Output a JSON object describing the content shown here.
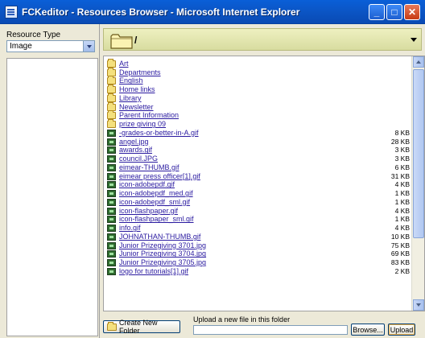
{
  "window": {
    "title": "FCKeditor - Resources Browser - Microsoft Internet Explorer",
    "min_glyph": "_",
    "max_glyph": "□",
    "close_glyph": "✕"
  },
  "sidebar": {
    "resource_type_label": "Resource Type",
    "resource_type_value": "Image"
  },
  "pathbar": {
    "path": "/"
  },
  "files": [
    {
      "type": "folder",
      "name": "Art",
      "size": ""
    },
    {
      "type": "folder",
      "name": "Departments",
      "size": ""
    },
    {
      "type": "folder",
      "name": "English",
      "size": ""
    },
    {
      "type": "folder",
      "name": "Home links",
      "size": ""
    },
    {
      "type": "folder",
      "name": "Library",
      "size": ""
    },
    {
      "type": "folder",
      "name": "Newsletter",
      "size": ""
    },
    {
      "type": "folder",
      "name": "Parent Information",
      "size": ""
    },
    {
      "type": "folder",
      "name": "prize giving 09",
      "size": ""
    },
    {
      "type": "image",
      "name": "-grades-or-better-in-A.gif",
      "size": "8 KB"
    },
    {
      "type": "image",
      "name": "angel.jpg",
      "size": "28 KB"
    },
    {
      "type": "image",
      "name": "awards.gif",
      "size": "3 KB"
    },
    {
      "type": "image",
      "name": "council.JPG",
      "size": "3 KB"
    },
    {
      "type": "image",
      "name": "eimear-THUMB.gif",
      "size": "6 KB"
    },
    {
      "type": "image",
      "name": "eimear press officer[1].gif",
      "size": "31 KB"
    },
    {
      "type": "image",
      "name": "icon-adobepdf.gif",
      "size": "4 KB"
    },
    {
      "type": "image",
      "name": "icon-adobepdf_med.gif",
      "size": "1 KB"
    },
    {
      "type": "image",
      "name": "icon-adobepdf_sml.gif",
      "size": "1 KB"
    },
    {
      "type": "image",
      "name": "icon-flashpaper.gif",
      "size": "4 KB"
    },
    {
      "type": "image",
      "name": "icon-flashpaper_sml.gif",
      "size": "1 KB"
    },
    {
      "type": "image",
      "name": "info.gif",
      "size": "4 KB"
    },
    {
      "type": "image",
      "name": "JOHNATHAN-THUMB.gif",
      "size": "10 KB"
    },
    {
      "type": "image",
      "name": "Junior Prizegiving 3701.jpg",
      "size": "75 KB"
    },
    {
      "type": "image",
      "name": "Junior Prizegiving 3704.jpg",
      "size": "69 KB"
    },
    {
      "type": "image",
      "name": "Junior Prizegiving 3705.jpg",
      "size": "83 KB"
    },
    {
      "type": "image",
      "name": "logo for tutorials[1].gif",
      "size": "2 KB"
    }
  ],
  "bottom": {
    "create_folder_label": "Create New Folder",
    "upload_label": "Upload a new file in this folder",
    "browse_label": "Browse...",
    "upload_button_label": "Upload"
  }
}
